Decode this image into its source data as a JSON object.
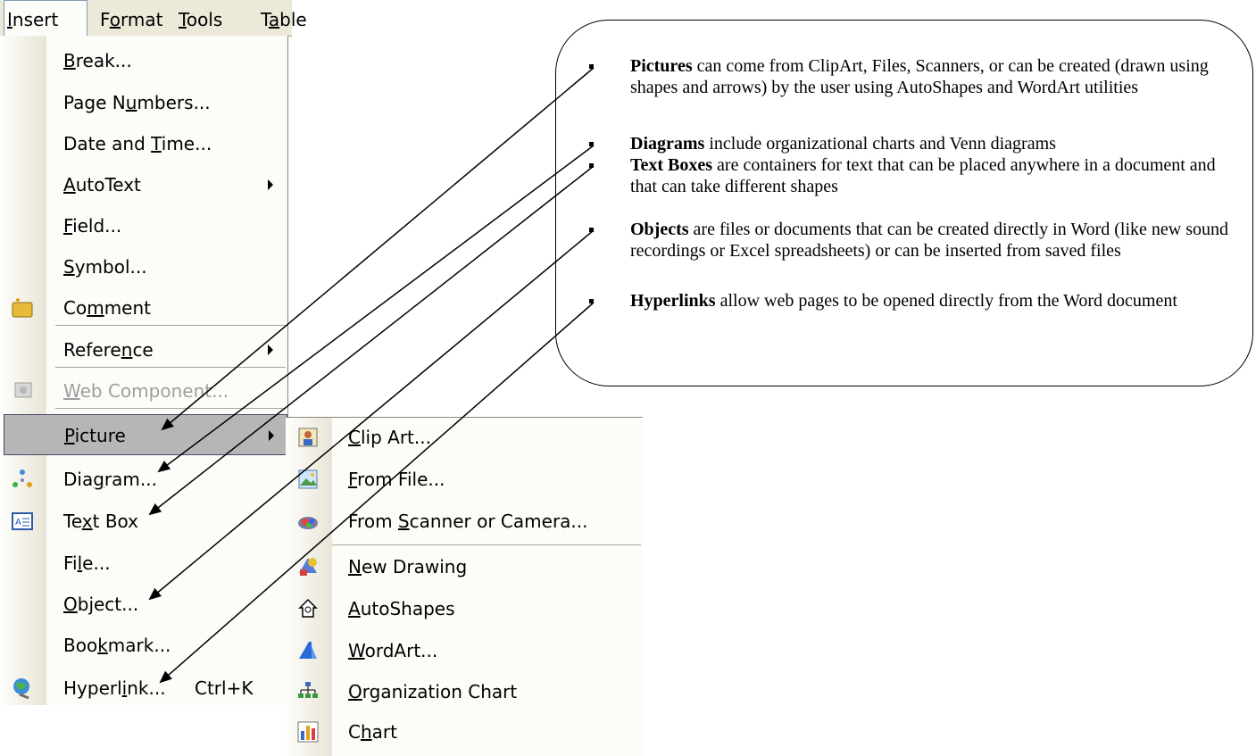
{
  "menubar": {
    "items": [
      {
        "label": "Insert",
        "mnemonic": "I"
      },
      {
        "label": "Format",
        "mnemonic": "o"
      },
      {
        "label": "Tools",
        "mnemonic": "T"
      },
      {
        "label": "Table",
        "mnemonic": "a"
      }
    ]
  },
  "insert_menu": {
    "items": [
      {
        "label": "Break...",
        "mnemonic": "B"
      },
      {
        "label": "Page Numbers...",
        "mnemonic": "u"
      },
      {
        "label": "Date and Time...",
        "mnemonic": "T"
      },
      {
        "label": "AutoText",
        "mnemonic": "A",
        "submenu": true
      },
      {
        "label": "Field...",
        "mnemonic": "F"
      },
      {
        "label": "Symbol...",
        "mnemonic": "S"
      },
      {
        "label": "Comment",
        "mnemonic": "m",
        "icon": "comment-icon"
      },
      {
        "label": "Reference",
        "mnemonic": "n",
        "submenu": true
      },
      {
        "label": "Web Component...",
        "mnemonic": "W",
        "disabled": true,
        "icon": "web-component-icon"
      },
      {
        "label": "Picture",
        "mnemonic": "P",
        "submenu": true,
        "highlighted": true
      },
      {
        "label": "Diagram...",
        "mnemonic": "g",
        "icon": "diagram-icon"
      },
      {
        "label": "Text Box",
        "mnemonic": "x",
        "icon": "text-box-icon"
      },
      {
        "label": "File...",
        "mnemonic": "l"
      },
      {
        "label": "Object...",
        "mnemonic": "O"
      },
      {
        "label": "Bookmark...",
        "mnemonic": "k"
      },
      {
        "label": "Hyperlink...",
        "mnemonic": "i",
        "shortcut": "Ctrl+K",
        "icon": "hyperlink-icon"
      }
    ]
  },
  "picture_submenu": {
    "items": [
      {
        "label": "Clip Art...",
        "mnemonic": "C",
        "icon": "clip-art-icon"
      },
      {
        "label": "From File...",
        "mnemonic": "F",
        "icon": "from-file-icon"
      },
      {
        "label": "From Scanner or Camera...",
        "mnemonic": "S",
        "icon": "scanner-camera-icon"
      },
      {
        "label": "New Drawing",
        "mnemonic": "N",
        "icon": "new-drawing-icon"
      },
      {
        "label": "AutoShapes",
        "mnemonic": "A",
        "icon": "autoshapes-icon"
      },
      {
        "label": "WordArt...",
        "mnemonic": "W",
        "icon": "wordart-icon"
      },
      {
        "label": "Organization Chart",
        "mnemonic": "O",
        "icon": "organization-chart-icon"
      },
      {
        "label": "Chart",
        "mnemonic": "h",
        "icon": "chart-icon"
      }
    ]
  },
  "callout": {
    "notes": [
      {
        "term": "Pictures",
        "text": " can come from ClipArt, Files, Scanners, or can be created (drawn using shapes and arrows) by the user using AutoShapes and WordArt utilities"
      },
      {
        "term": "Diagrams",
        "text": " include organizational charts and Venn diagrams"
      },
      {
        "term": "Text Boxes",
        "text": " are containers for text that can be placed anywhere in a document and that can take different shapes"
      },
      {
        "term": "Objects",
        "text": " are files or documents that can be created directly in Word (like new sound recordings or Excel spreadsheets) or can be inserted from saved files"
      },
      {
        "term": "Hyperlinks",
        "text": " allow web pages to be opened directly from the Word document"
      }
    ]
  }
}
